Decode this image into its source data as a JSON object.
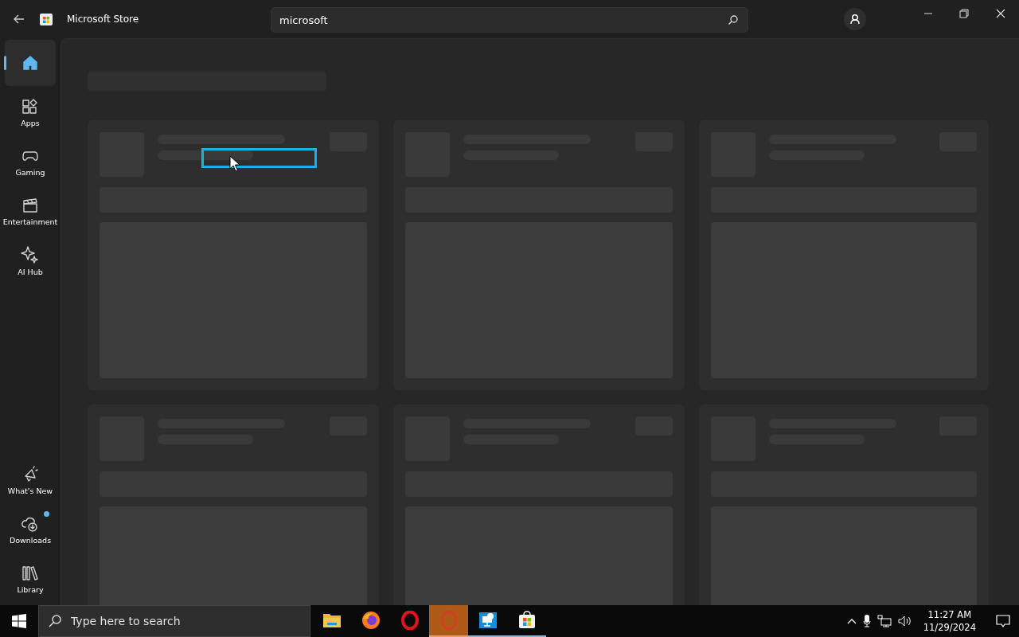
{
  "window": {
    "title": "Microsoft Store"
  },
  "search": {
    "value": "microsoft"
  },
  "nav": [
    {
      "selected": true
    },
    {
      "label": "Apps",
      "selected": false
    },
    {
      "label": "Gaming",
      "selected": false
    },
    {
      "label": "Entertainment",
      "selected": false
    },
    {
      "label": "AI Hub",
      "selected": false
    }
  ],
  "nav_bottom": [
    {
      "label": "What's New",
      "selected": false,
      "badge": false
    },
    {
      "label": "Downloads",
      "selected": false,
      "badge": true
    },
    {
      "label": "Library",
      "selected": false,
      "badge": false
    }
  ],
  "cards": [
    {
      "kind": "skeleton"
    },
    {
      "kind": "skeleton"
    },
    {
      "kind": "skeleton"
    },
    {
      "kind": "skeleton"
    },
    {
      "kind": "skeleton"
    },
    {
      "kind": "skeleton"
    }
  ],
  "taskbar": {
    "search_placeholder": "Type here to search",
    "apps": [
      {
        "kind": "folder",
        "selected": false,
        "running": false
      },
      {
        "kind": "browser-fox",
        "selected": false,
        "running": false
      },
      {
        "kind": "browser-o",
        "selected": false,
        "running": false
      },
      {
        "kind": "browser-o-dim",
        "selected": true,
        "running": true
      },
      {
        "kind": "remote",
        "selected": false,
        "running": true
      },
      {
        "kind": "store",
        "selected": false,
        "running": true
      }
    ],
    "time": "11:27 AM",
    "date": "11/29/2024"
  }
}
